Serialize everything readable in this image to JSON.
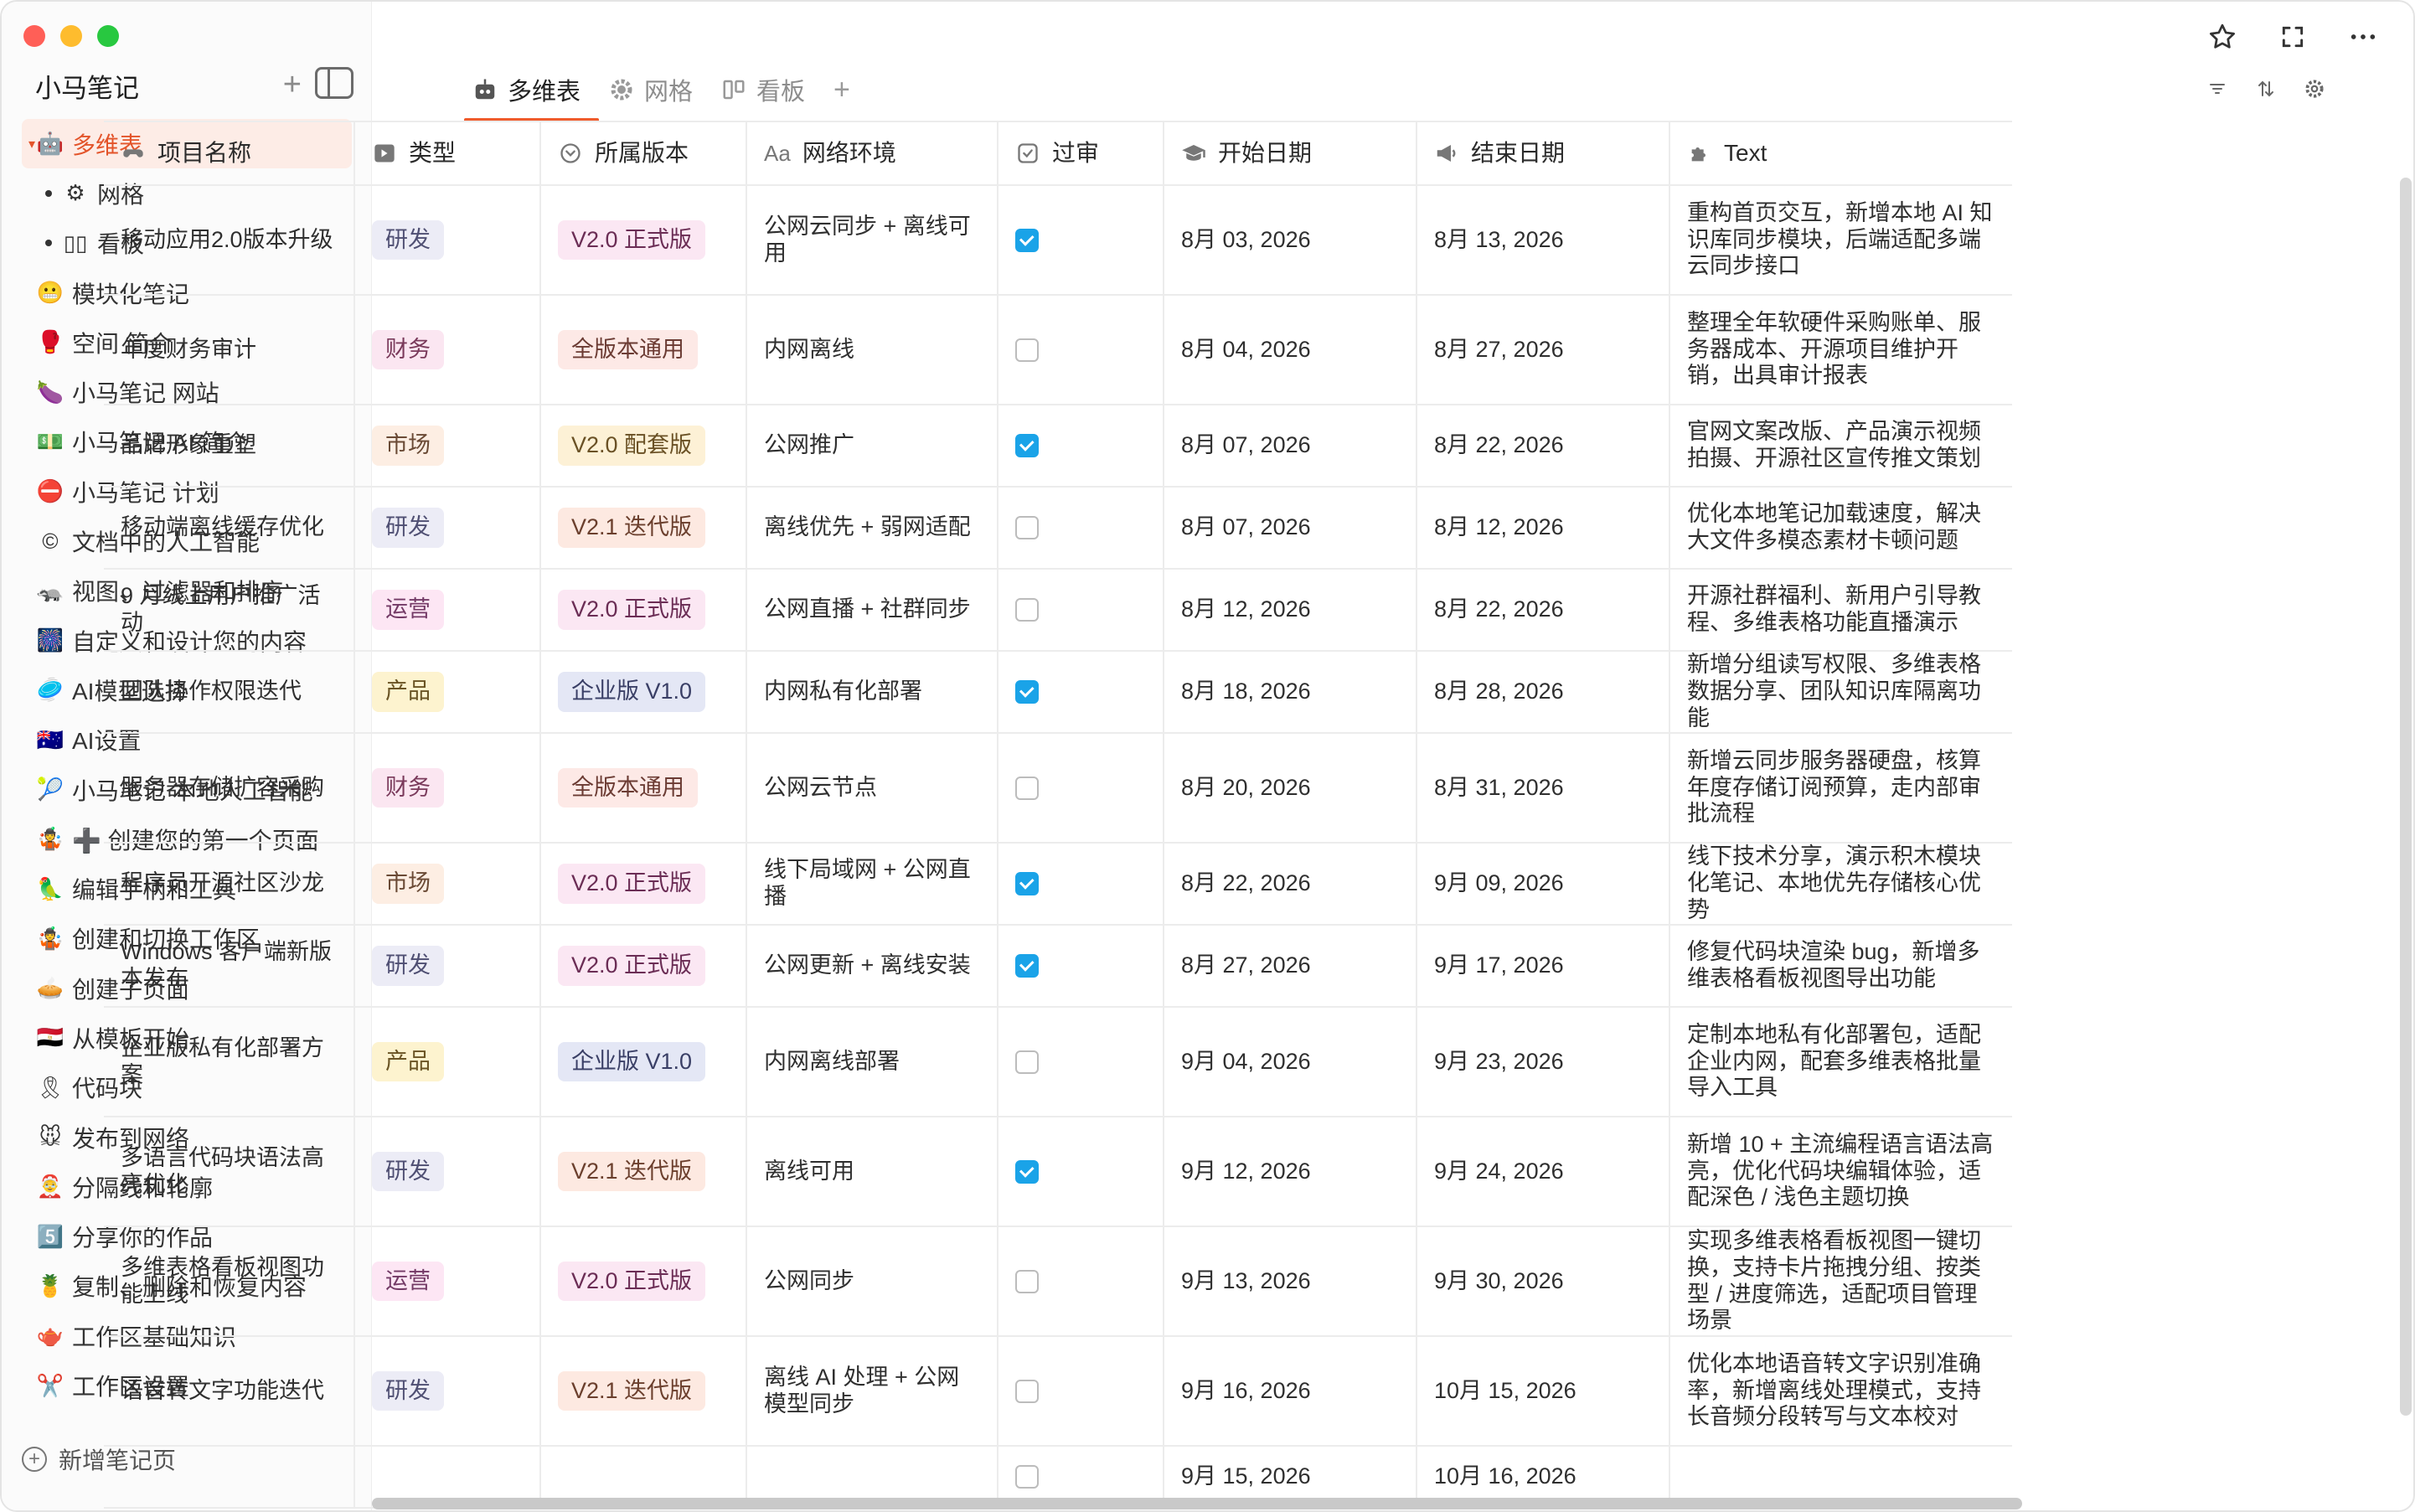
{
  "app": {
    "name": "小马笔记"
  },
  "sidebar": {
    "items": [
      {
        "label": "多维表",
        "icon": "🤖",
        "active": true
      },
      {
        "label": "网格",
        "icon": "⚙",
        "sub": true
      },
      {
        "label": "看板",
        "icon": "▯▯",
        "sub": true
      },
      {
        "label": "模块化笔记",
        "icon": "😬"
      },
      {
        "label": "空间 简介",
        "icon": "🥊"
      },
      {
        "label": "小马笔记 网站",
        "icon": "🍆"
      },
      {
        "label": "小马笔记 AI 简介",
        "icon": "💵"
      },
      {
        "label": "小马笔记 计划",
        "icon": "⛔"
      },
      {
        "label": "文档中的人工智能",
        "icon": "©"
      },
      {
        "label": "视图、过滤器和排序",
        "icon": "🦡"
      },
      {
        "label": "自定义和设计您的内容",
        "icon": "🎆"
      },
      {
        "label": "AI模型选择",
        "icon": "🥏"
      },
      {
        "label": "AI设置",
        "icon": "🇦🇺"
      },
      {
        "label": "小马笔记 本地人工智能",
        "icon": "🎾"
      },
      {
        "label": "➕ 创建您的第一个页面",
        "icon": "🤹"
      },
      {
        "label": "编辑手柄和工具",
        "icon": "🦜"
      },
      {
        "label": "创建和切换工作区",
        "icon": "🤹"
      },
      {
        "label": "创建子页面",
        "icon": "🥧"
      },
      {
        "label": "从模板开始",
        "icon": "🇪🇬"
      },
      {
        "label": "代码块",
        "icon": "🎗"
      },
      {
        "label": "发布到网络",
        "icon": "🐭"
      },
      {
        "label": "分隔线和轮廓",
        "icon": "🤶"
      },
      {
        "label": "分享你的作品",
        "icon": "5️⃣"
      },
      {
        "label": "复制、删除和恢复内容",
        "icon": "🍍"
      },
      {
        "label": "工作区基础知识",
        "icon": "🫖"
      },
      {
        "label": "工作区设置",
        "icon": "✂️"
      }
    ],
    "footer_label": "新增笔记页"
  },
  "tabs": [
    {
      "label": "多维表",
      "icon": "robot-icon",
      "active": true
    },
    {
      "label": "网格",
      "icon": "gear-icon"
    },
    {
      "label": "看板",
      "icon": "board-icon"
    }
  ],
  "table": {
    "columns": [
      "项目名称",
      "类型",
      "所属版本",
      "网络环境",
      "过审",
      "开始日期",
      "结束日期",
      "Text"
    ],
    "rows": [
      {
        "name": "移动应用2.0版本升级",
        "type": "研发",
        "ver": "V2.0 正式版",
        "vc": "a",
        "net": "公网云同步 + 离线可用",
        "ok": true,
        "start": "8月 03, 2026",
        "end": "8月 13, 2026",
        "text": "重构首页交互，新增本地 AI 知识库同步模块，后端适配多端云同步接口",
        "h": 131
      },
      {
        "name": "年度财务审计",
        "type": "财务",
        "ver": "全版本通用",
        "vc": "b",
        "net": "内网离线",
        "ok": false,
        "start": "8月 04, 2026",
        "end": "8月 27, 2026",
        "text": "整理全年软硬件采购账单、服务器成本、开源项目维护开销，出具审计报表",
        "h": 131
      },
      {
        "name": "品牌形象重塑",
        "type": "市场",
        "ver": "V2.0 配套版",
        "vc": "c",
        "net": "公网推广",
        "ok": true,
        "start": "8月 07, 2026",
        "end": "8月 22, 2026",
        "text": "官网文案改版、产品演示视频拍摄、开源社区宣传推文策划",
        "h": 98
      },
      {
        "name": "移动端离线缓存优化",
        "type": "研发",
        "ver": "V2.1 迭代版",
        "vc": "d",
        "net": "离线优先 + 弱网适配",
        "ok": false,
        "start": "8月 07, 2026",
        "end": "8月 12, 2026",
        "text": "优化本地笔记加载速度，解决大文件多模态素材卡顿问题",
        "h": 98
      },
      {
        "name": "9 月线上用户推广活动",
        "type": "运营",
        "ver": "V2.0 正式版",
        "vc": "a",
        "net": "公网直播 + 社群同步",
        "ok": false,
        "start": "8月 12, 2026",
        "end": "8月 22, 2026",
        "text": "开源社群福利、新用户引导教程、多维表格功能直播演示",
        "h": 98
      },
      {
        "name": "团队协作权限迭代",
        "type": "产品",
        "ver": "企业版 V1.0",
        "vc": "e",
        "net": "内网私有化部署",
        "ok": true,
        "start": "8月 18, 2026",
        "end": "8月 28, 2026",
        "text": "新增分组读写权限、多维表格数据分享、团队知识库隔离功能",
        "h": 98
      },
      {
        "name": "服务器存储扩容采购",
        "type": "财务",
        "ver": "全版本通用",
        "vc": "b",
        "net": "公网云节点",
        "ok": false,
        "start": "8月 20, 2026",
        "end": "8月 31, 2026",
        "text": "新增云同步服务器硬盘，核算年度存储订阅预算，走内部审批流程",
        "h": 131
      },
      {
        "name": "程序员开源社区沙龙",
        "type": "市场",
        "ver": "V2.0 正式版",
        "vc": "a",
        "net": "线下局域网 + 公网直播",
        "ok": true,
        "start": "8月 22, 2026",
        "end": "9月 09, 2026",
        "text": "线下技术分享，演示积木模块化笔记、本地优先存储核心优势",
        "h": 98
      },
      {
        "name": "Windows 客户端新版本发布",
        "type": "研发",
        "ver": "V2.0 正式版",
        "vc": "a",
        "net": "公网更新 + 离线安装",
        "ok": true,
        "start": "8月 27, 2026",
        "end": "9月 17, 2026",
        "text": "修复代码块渲染 bug，新增多维表格看板视图导出功能",
        "h": 98
      },
      {
        "name": "企业版私有化部署方案",
        "type": "产品",
        "ver": "企业版 V1.0",
        "vc": "e",
        "net": "内网离线部署",
        "ok": false,
        "start": "9月 04, 2026",
        "end": "9月 23, 2026",
        "text": "定制本地私有化部署包，适配企业内网，配套多维表格批量导入工具",
        "h": 131
      },
      {
        "name": "多语言代码块语法高亮优化",
        "type": "研发",
        "ver": "V2.1 迭代版",
        "vc": "d",
        "net": "离线可用",
        "ok": true,
        "start": "9月 12, 2026",
        "end": "9月 24, 2026",
        "text": "新增 10 + 主流编程语言语法高亮，优化代码块编辑体验，适配深色 / 浅色主题切换",
        "h": 131
      },
      {
        "name": "多维表格看板视图功能上线",
        "type": "运营",
        "ver": "V2.0 正式版",
        "vc": "a",
        "net": "公网同步",
        "ok": false,
        "start": "9月 13, 2026",
        "end": "9月 30, 2026",
        "text": "实现多维表格看板视图一键切换，支持卡片拖拽分组、按类型 / 进度筛选，适配项目管理场景",
        "h": 131
      },
      {
        "name": "语音转文字功能迭代",
        "type": "研发",
        "ver": "V2.1 迭代版",
        "vc": "d",
        "net": "离线 AI 处理 + 公网模型同步",
        "ok": false,
        "start": "9月 16, 2026",
        "end": "10月 15, 2026",
        "text": "优化本地语音转文字识别准确率，新增离线处理模式，支持长音频分段转写与文本校对",
        "h": 131
      },
      {
        "name": "",
        "type": "",
        "ver": "",
        "vc": "",
        "net": "",
        "ok": false,
        "start": "9月 15, 2026",
        "end": "10月 16, 2026",
        "text": "",
        "h": 74
      }
    ]
  }
}
